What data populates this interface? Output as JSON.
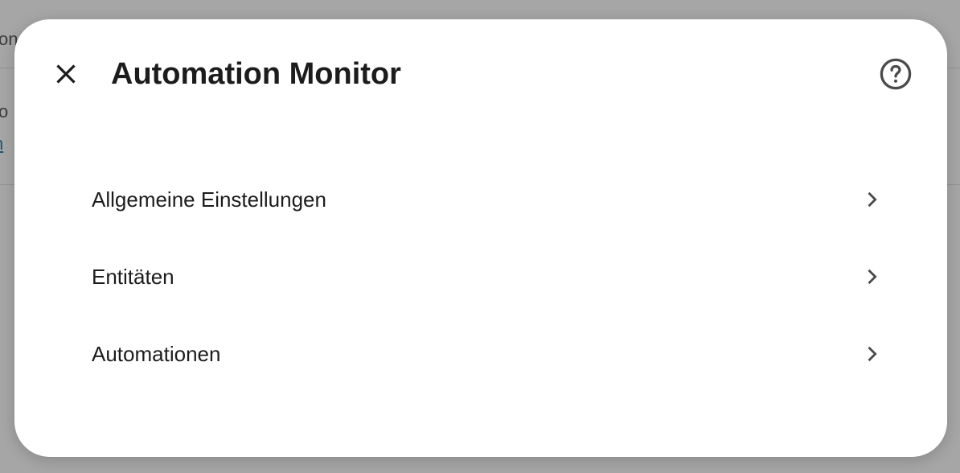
{
  "background": {
    "text_top": "on",
    "text_mid": "o",
    "link_text": "n"
  },
  "dialog": {
    "title": "Automation Monitor",
    "close_icon": "close-icon",
    "help_icon": "help-circle-icon",
    "menu_items": [
      {
        "label": "Allgemeine Einstellungen",
        "icon": "chevron-right-icon"
      },
      {
        "label": "Entitäten",
        "icon": "chevron-right-icon"
      },
      {
        "label": "Automationen",
        "icon": "chevron-right-icon"
      }
    ]
  },
  "colors": {
    "scrim": "#a6a6a6",
    "dialog_bg": "#ffffff",
    "text": "#1c1c1c",
    "icon": "#4a4a4a"
  }
}
